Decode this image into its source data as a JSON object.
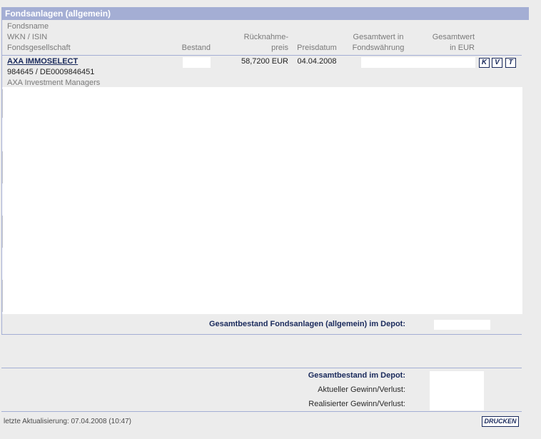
{
  "section": {
    "title": "Fondsanlagen (allgemein)"
  },
  "columns": {
    "fund": [
      "Fondsname",
      "WKN / ISIN",
      "Fondsgesellschaft"
    ],
    "bestand": "Bestand",
    "price": [
      "Rücknahme-",
      "preis"
    ],
    "price_date": "Preisdatum",
    "total_fund_currency": [
      "Gesamtwert in",
      "Fondswährung"
    ],
    "total_eur": [
      "Gesamtwert",
      "in EUR"
    ]
  },
  "rows": [
    {
      "name": "AXA IMMOSELECT",
      "codes": "984645 /  DE0009846451",
      "company": "AXA Investment Managers",
      "bestand": "",
      "price": "58,7200 EUR",
      "price_date": "04.04.2008",
      "total_fund_currency": "",
      "total_eur": "",
      "actions": [
        "K",
        "V",
        "T"
      ]
    }
  ],
  "subtotal": {
    "label": "Gesamtbestand Fondsanlagen (allgemein) im Depot:",
    "value": ""
  },
  "summary": {
    "total_label": "Gesamtbestand im Depot:",
    "gain_label": "Aktueller Gewinn/Verlust:",
    "realized_label": "Realisierter Gewinn/Verlust:"
  },
  "footer": {
    "last_update": "letzte Aktualisierung: 07.04.2008 (10:47)",
    "print_label": "DRUCKEN"
  }
}
